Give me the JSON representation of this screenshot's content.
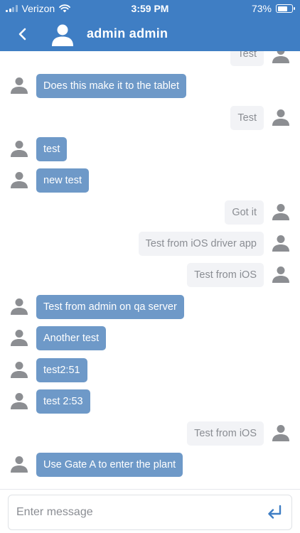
{
  "status_bar": {
    "carrier": "Verizon",
    "time": "3:59 PM",
    "battery_percent": "73%",
    "battery_level": 0.73,
    "icons": [
      "signal-icon",
      "wifi-icon",
      "battery-icon"
    ]
  },
  "header": {
    "title": "admin admin",
    "back_icon": "chevron-left-icon",
    "avatar_icon": "user-icon"
  },
  "messages": [
    {
      "from": "me",
      "text": "Test"
    },
    {
      "from": "other",
      "text": "Does this make it to the tablet"
    },
    {
      "from": "me",
      "text": "Test"
    },
    {
      "from": "other",
      "text": "test"
    },
    {
      "from": "other",
      "text": "new test"
    },
    {
      "from": "me",
      "text": "Got it"
    },
    {
      "from": "me",
      "text": "Test from iOS driver app"
    },
    {
      "from": "me",
      "text": "Test from iOS"
    },
    {
      "from": "other",
      "text": "Test from admin on qa server"
    },
    {
      "from": "other",
      "text": "Another test"
    },
    {
      "from": "other",
      "text": "test2:51"
    },
    {
      "from": "other",
      "text": "test 2:53"
    },
    {
      "from": "me",
      "text": "Test from iOS"
    },
    {
      "from": "other",
      "text": "Use Gate A to enter the plant"
    }
  ],
  "composer": {
    "placeholder": "Enter message",
    "value": "",
    "send_icon": "return-arrow-icon"
  },
  "colors": {
    "brand": "#3f7ec4",
    "incoming_bubble": "#6e99c8",
    "outgoing_bubble": "#f2f3f6",
    "avatar": "#8c8e92",
    "send_icon": "#3f7ec4"
  }
}
